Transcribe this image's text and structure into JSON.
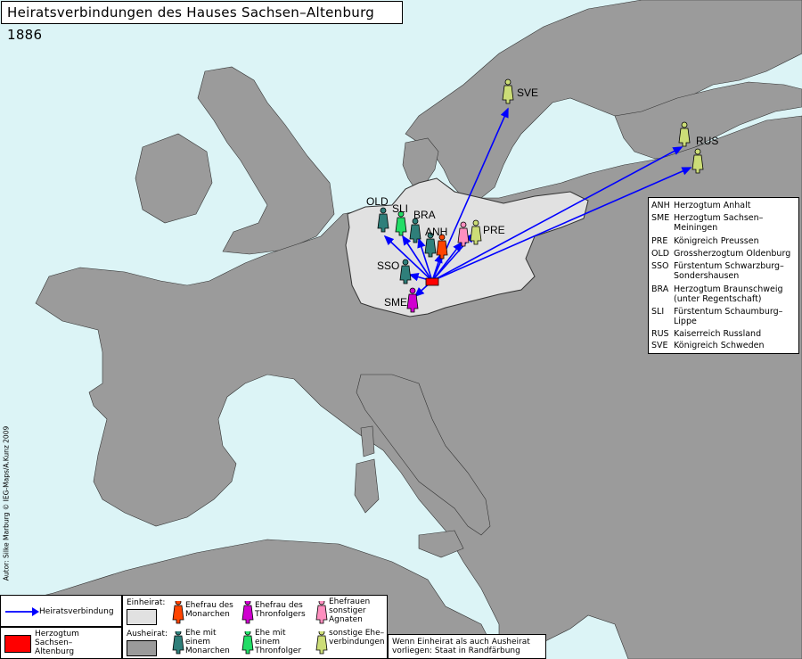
{
  "title": "Heiratsverbindungen des Hauses Sachsen–Altenburg 1886",
  "author_credit": "Autor: Silke Marburg © IEG-Maps/A.Kunz 2009",
  "colors": {
    "sea": "#dcf4f6",
    "land": "#9b9b9b",
    "hre_area": "#e1e1e1",
    "arrow": "#0000ff",
    "sachsen_altenburg": "#ff0000",
    "monarch_wife": "#ff4400",
    "heir_wife": "#d000d0",
    "agnate_wife": "#ff8fbf",
    "married_monarch": "#2f7f7a",
    "married_heir": "#22dd66",
    "other_marriage": "#ccdd77"
  },
  "state_labels": {
    "OLD": "OLD",
    "SLI": "SLI",
    "BRA": "BRA",
    "ANH": "ANH",
    "SSO": "SSO",
    "SME": "SME",
    "PRE": "PRE",
    "RUS": "RUS",
    "SVE": "SVE"
  },
  "legend_abbreviations": [
    {
      "code": "ANH",
      "name": "Herzogtum Anhalt"
    },
    {
      "code": "SME",
      "name": "Herzogtum Sachsen–Meiningen"
    },
    {
      "code": "PRE",
      "name": "Königreich Preussen"
    },
    {
      "code": "OLD",
      "name": "Grossherzogtum Oldenburg"
    },
    {
      "code": "SSO",
      "name": "Fürstentum Schwarzburg–Sondershausen"
    },
    {
      "code": "BRA",
      "name": "Herzogtum Braunschweig (unter Regentschaft)"
    },
    {
      "code": "SLI",
      "name": "Fürstentum Schaumburg–Lippe"
    },
    {
      "code": "RUS",
      "name": "Kaiserreich Russland"
    },
    {
      "code": "SVE",
      "name": "Königreich Schweden"
    }
  ],
  "legend_bottom": {
    "arrow_label": "Heiratsverbindung",
    "home_label": "Herzogtum Sachsen– Altenburg",
    "einheirat_label": "Einheirat:",
    "ausheirat_label": "Ausheirat:",
    "monarch_wife": "Ehefrau des Monarchen",
    "heir_wife": "Ehefrau des Thronfolgers",
    "agnate_wife": "Ehefrauen sonstiger Agnaten",
    "married_monarch": "Ehe mit einem Monarchen",
    "married_heir": "Ehe mit einem Thronfolger",
    "other_marriage": "sonstige Ehe– verbindungen",
    "note": "Wenn Einheirat als auch Ausheirat vorliegen: Staat in Randfärbung"
  }
}
